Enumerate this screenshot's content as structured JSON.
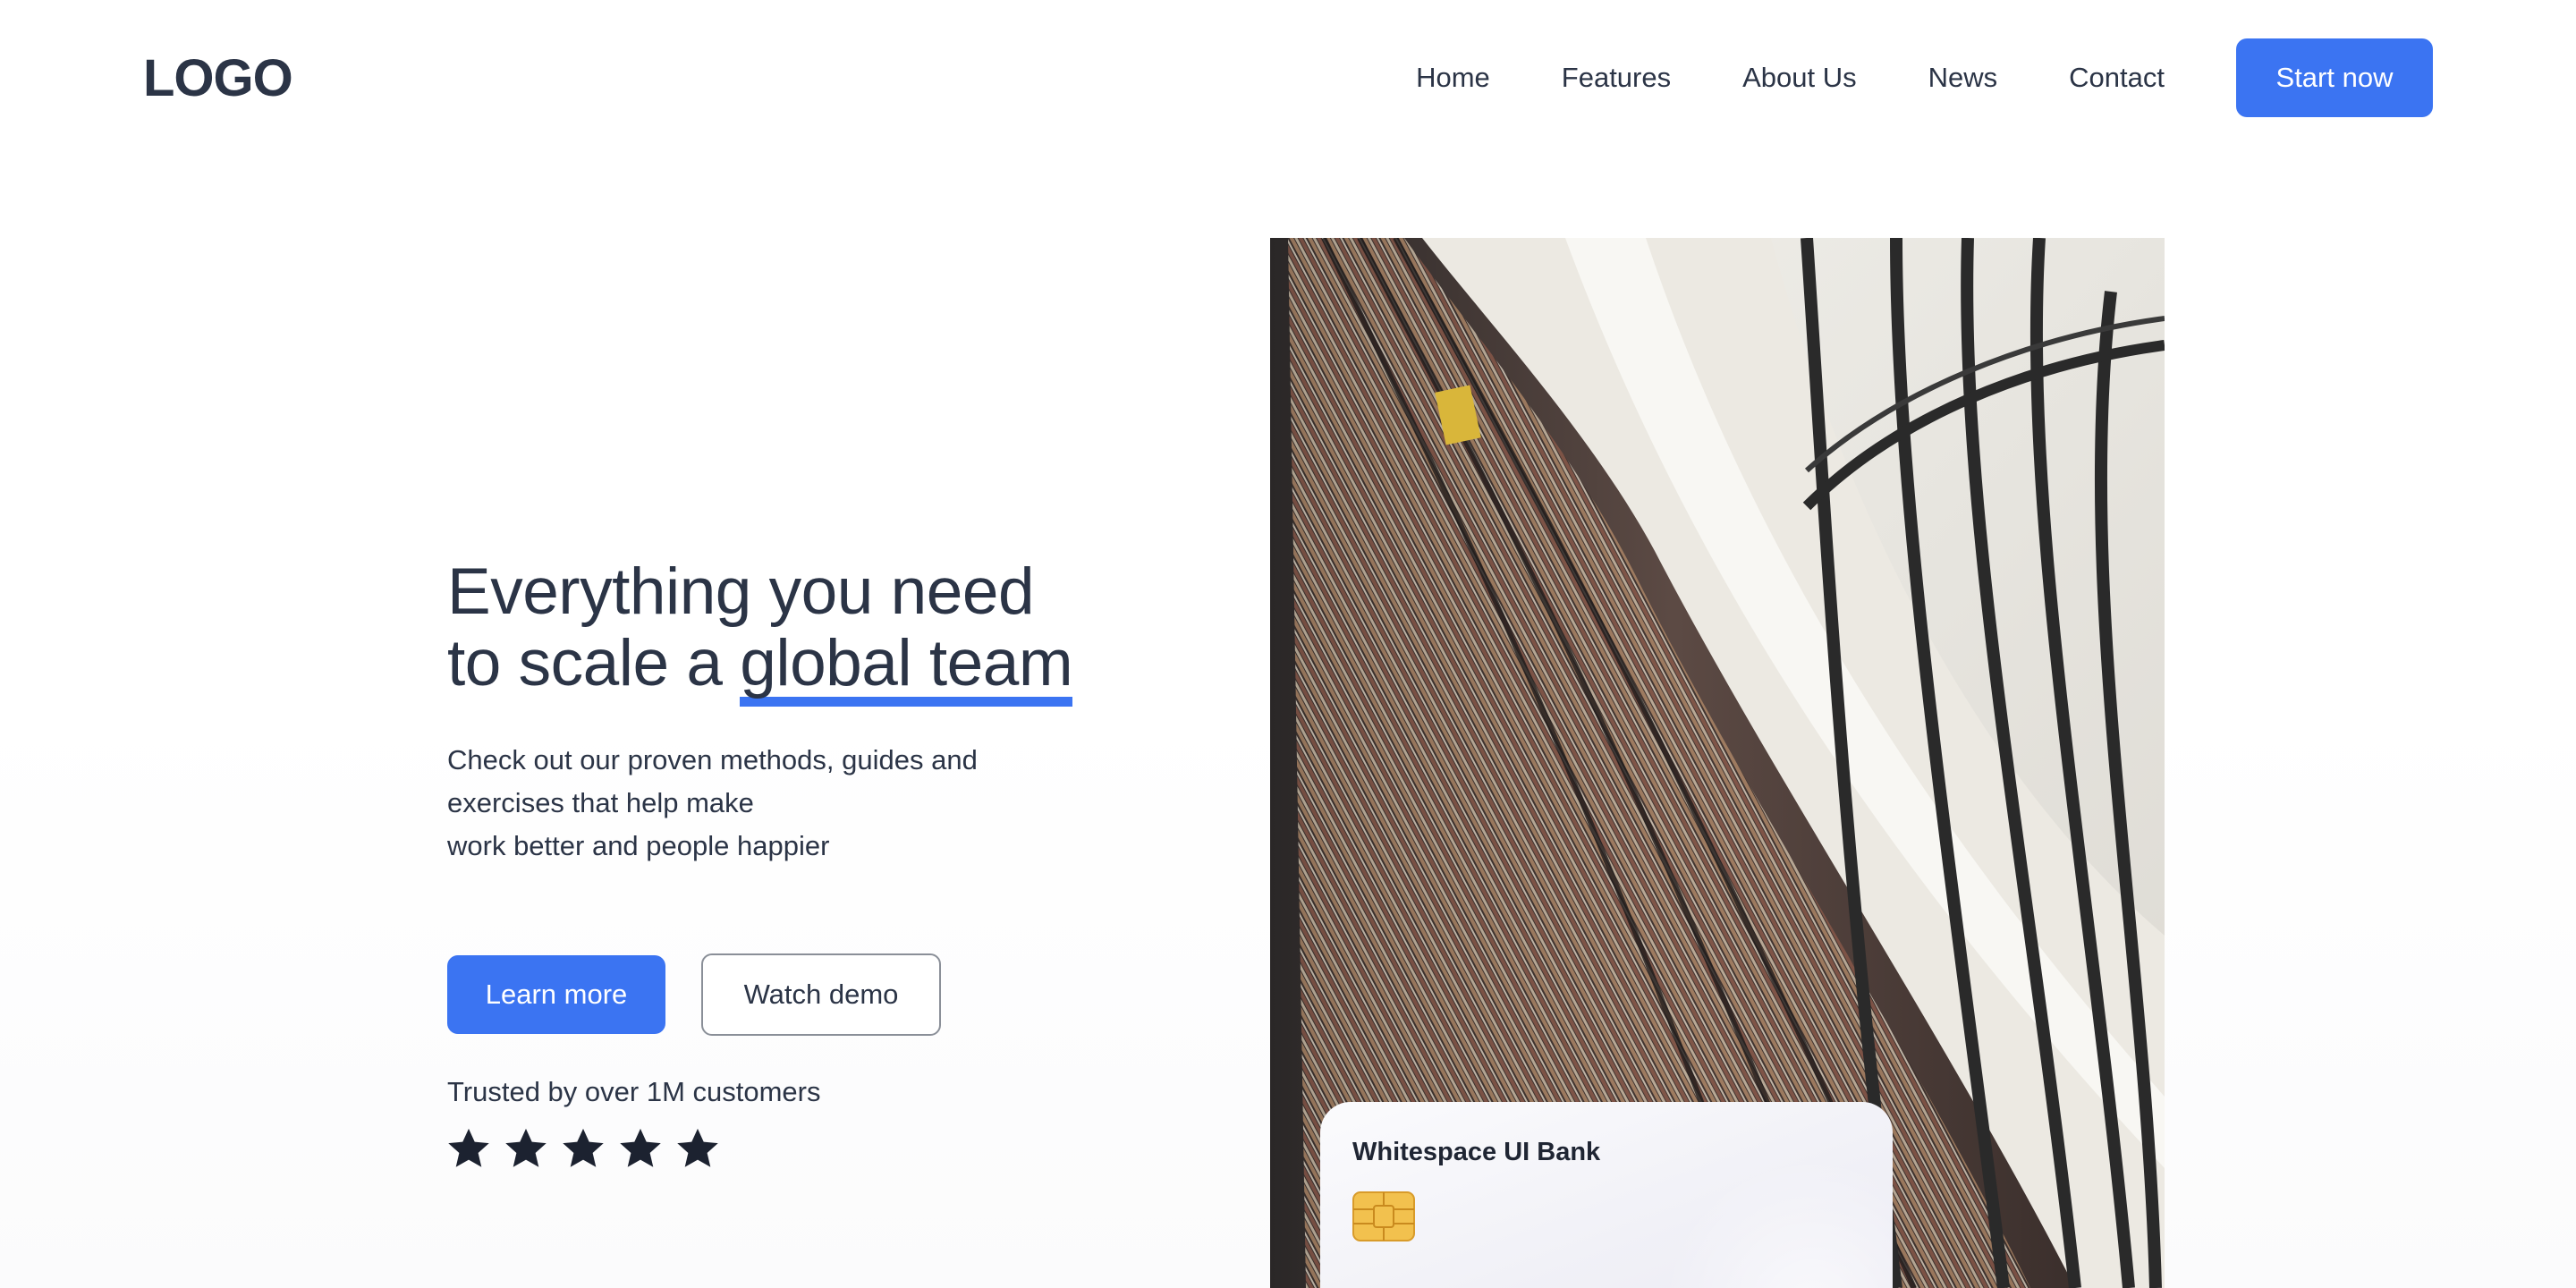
{
  "header": {
    "logo": "LOGO",
    "nav": [
      "Home",
      "Features",
      "About Us",
      "News",
      "Contact"
    ],
    "cta": "Start now"
  },
  "hero": {
    "title_line1": "Everything you need",
    "title_line2_prefix": "to scale a ",
    "title_highlight": "global team",
    "description": [
      "Check out our proven methods, guides and",
      "exercises that help make",
      "work better and people happier"
    ],
    "primary_button": "Learn more",
    "secondary_button": "Watch demo",
    "trusted_text": "Trusted by over 1M customers",
    "rating_stars": 5
  },
  "card": {
    "bank_name": "Whitespace UI Bank",
    "chip_icon": "sim-chip-icon"
  },
  "colors": {
    "accent": "#3b74f2",
    "text": "#2b3446",
    "star": "#1c2230"
  }
}
